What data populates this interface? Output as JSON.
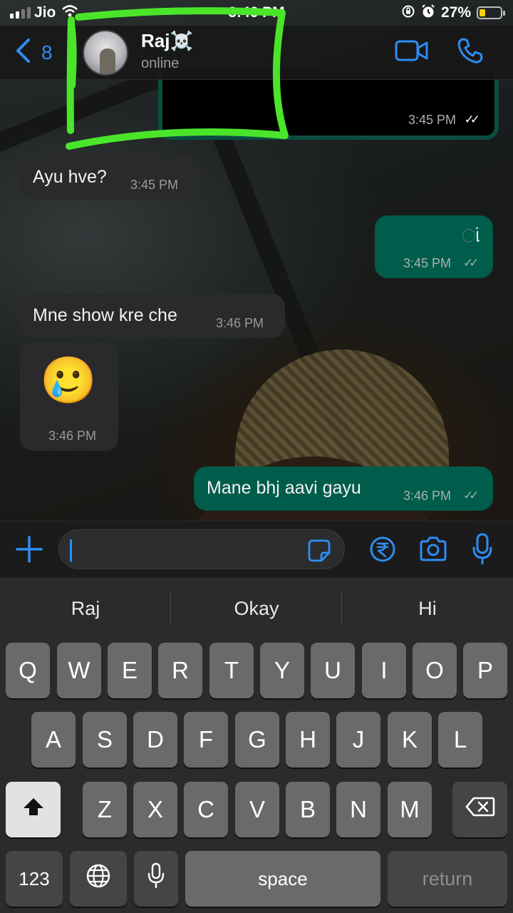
{
  "status_bar": {
    "carrier": "Jio",
    "time": "3:46 PM",
    "battery_percent": "27%",
    "battery_level": 0.27,
    "battery_color": "#f6d10a",
    "icons": [
      "signal-icon",
      "wifi-icon",
      "rotation-lock-icon",
      "alarm-icon",
      "battery-icon"
    ]
  },
  "header": {
    "back_count": "8",
    "contact_name": "Raj☠️",
    "presence": "online",
    "icons": [
      "chevron-left-icon",
      "avatar",
      "video-call-icon",
      "phone-icon"
    ]
  },
  "messages": [
    {
      "id": "prev",
      "direction": "out",
      "text": "",
      "time": "3:45 PM",
      "ticks": "✓✓",
      "read": true
    },
    {
      "id": "m1",
      "direction": "in",
      "text": "Ayu hve?",
      "time": "3:45 PM"
    },
    {
      "id": "m2",
      "direction": "out",
      "text": "ાં",
      "time": "3:45 PM",
      "ticks": "✓✓",
      "read": false
    },
    {
      "id": "m3",
      "direction": "in",
      "text": "Mne show kre che",
      "time": "3:46 PM"
    },
    {
      "id": "m4",
      "direction": "in",
      "text": "🥲",
      "time": "3:46 PM"
    },
    {
      "id": "m5",
      "direction": "out",
      "text": "Mane  bhj aavi gayu",
      "time": "3:46 PM",
      "ticks": "✓✓",
      "read": false
    }
  ],
  "composer": {
    "value": "",
    "icons": [
      "plus-icon",
      "sticker-icon",
      "payment-icon",
      "camera-icon",
      "mic-icon"
    ]
  },
  "keyboard": {
    "suggestions": [
      "Raj",
      "Okay",
      "Hi"
    ],
    "row1": [
      "Q",
      "W",
      "E",
      "R",
      "T",
      "Y",
      "U",
      "I",
      "O",
      "P"
    ],
    "row2": [
      "A",
      "S",
      "D",
      "F",
      "G",
      "H",
      "J",
      "K",
      "L"
    ],
    "row3": [
      "Z",
      "X",
      "C",
      "V",
      "B",
      "N",
      "M"
    ],
    "numbers_label": "123",
    "space_label": "space",
    "return_label": "return"
  },
  "colors": {
    "accent": "#2c8ef4",
    "outgoing_bubble": "#005c4b",
    "incoming_bubble": "#2a2a2c",
    "highlight_stroke": "#4ae52a"
  }
}
